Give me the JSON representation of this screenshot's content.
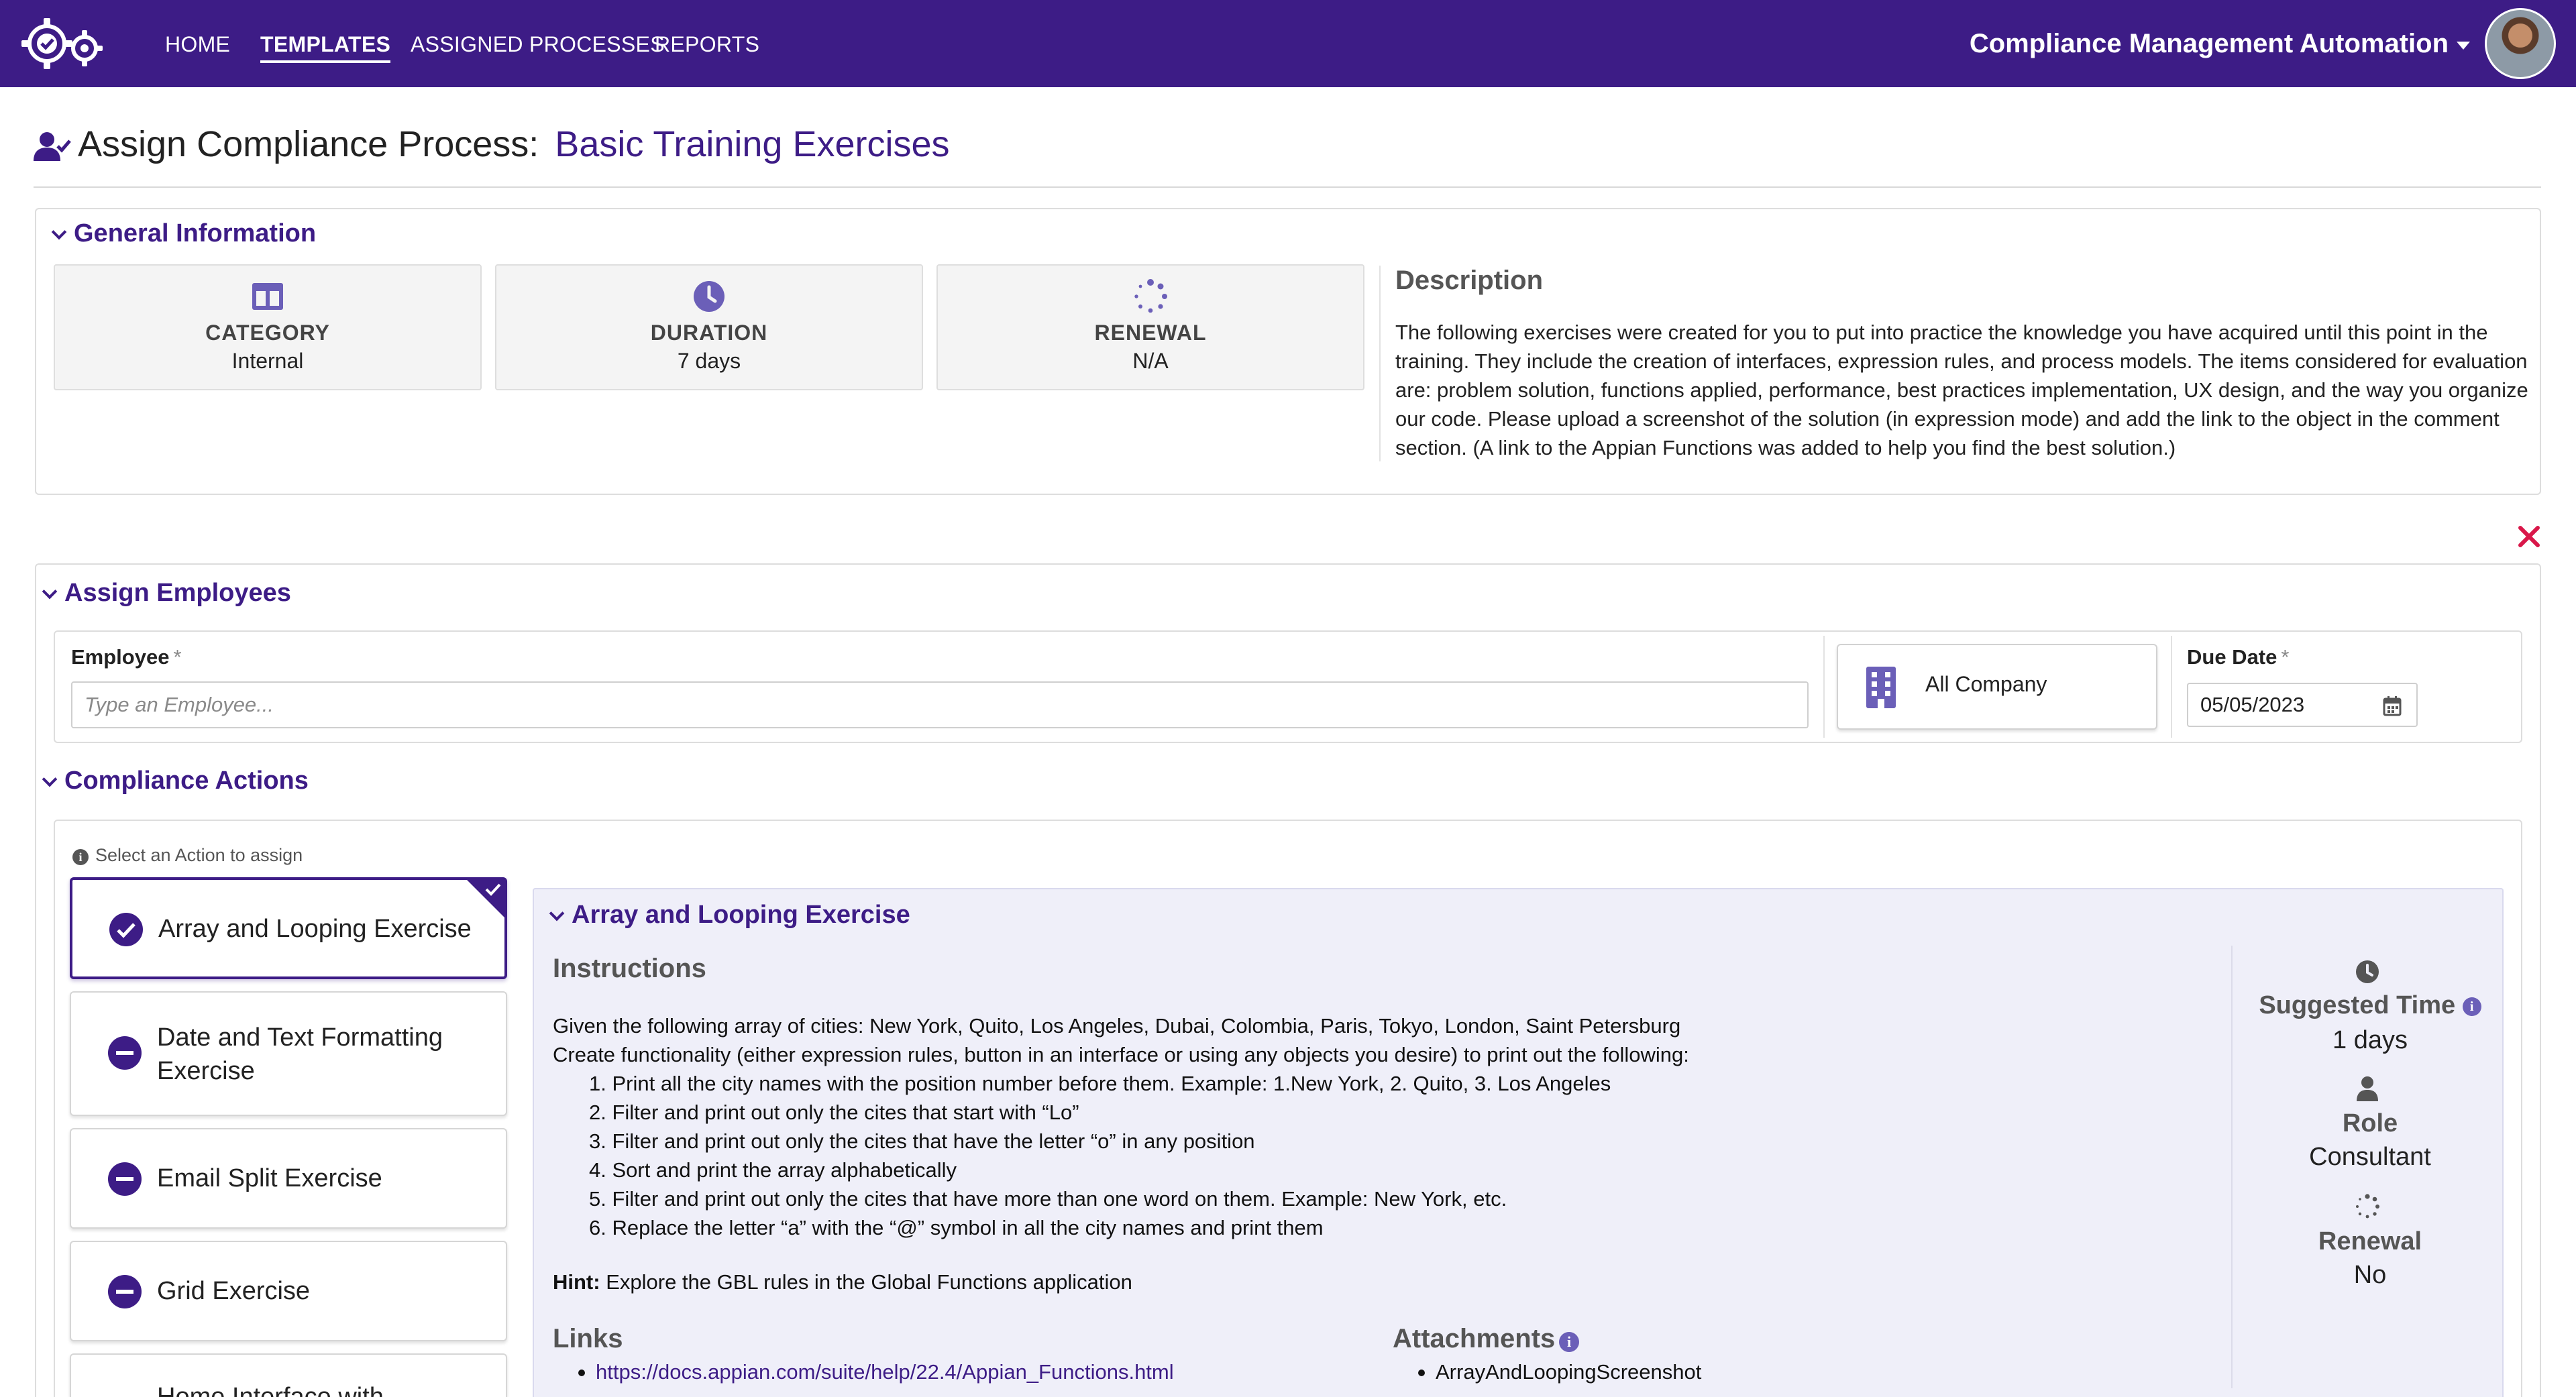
{
  "nav": {
    "items": [
      {
        "label": "HOME"
      },
      {
        "label": "TEMPLATES"
      },
      {
        "label": "ASSIGNED PROCESSES"
      },
      {
        "label": "REPORTS"
      }
    ],
    "active": "TEMPLATES",
    "app_title": "Compliance Management Automation"
  },
  "page": {
    "title_label": "Assign Compliance Process:",
    "title_value": "Basic Training Exercises"
  },
  "general": {
    "title": "General Information",
    "cards": [
      {
        "label": "CATEGORY",
        "value": "Internal",
        "icon": "layout-columns-icon"
      },
      {
        "label": "DURATION",
        "value": "7 days",
        "icon": "clock-icon"
      },
      {
        "label": "RENEWAL",
        "value": "N/A",
        "icon": "spinner-icon"
      }
    ],
    "description_title": "Description",
    "description": "The following exercises were created for you to put into practice the knowledge you have acquired until this point in the training. They include the creation of interfaces, expression rules, and process models. The items considered for evaluation are: problem solution, functions applied, performance, best practices implementation, UX design, and the way you organize our code. Please upload a screenshot of the solution (in expression mode) and add the link to the object in the comment section. (A link to the Appian Functions was added to help you find the best solution.)"
  },
  "assign": {
    "title": "Assign Employees",
    "employee_label": "Employee",
    "required_mark": "*",
    "employee_placeholder": "Type an Employee...",
    "company_button": "All Company",
    "due_label": "Due Date",
    "due_value": "05/05/2023"
  },
  "actions": {
    "title": "Compliance Actions",
    "hint": "Select an Action to assign",
    "items": [
      {
        "label": "Array and Looping Exercise",
        "selected": true
      },
      {
        "label": "Date and Text Formatting Exercise",
        "selected": false
      },
      {
        "label": "Email Split Exercise",
        "selected": false
      },
      {
        "label": "Grid Exercise",
        "selected": false
      },
      {
        "label": "Home Interface with",
        "selected": false
      }
    ]
  },
  "detail": {
    "title": "Array and Looping Exercise",
    "instructions_title": "Instructions",
    "intro_1": "Given the following array of cities: New York, Quito, Los Angeles, Dubai, Colombia, Paris, Tokyo, London, Saint Petersburg",
    "intro_2": "Create functionality (either expression rules, button in an interface or using any objects you desire) to print out the following:",
    "steps": [
      "1. Print all the city names with the position number before them. Example: 1.New York, 2. Quito, 3. Los Angeles",
      "2. Filter and print out only the cites that start with “Lo”",
      "3. Filter and print out only the cites that have the letter “o” in any position",
      "4. Sort and print the array alphabetically",
      "5. Filter and print out only the cites that have more than one word on them. Example: New York, etc.",
      "6. Replace the letter “a” with the “@” symbol in all the city names and print them"
    ],
    "hint_label": "Hint:",
    "hint_text": " Explore the GBL rules in the Global Functions application",
    "links_title": "Links",
    "link": "https://docs.appian.com/suite/help/22.4/Appian_Functions.html",
    "attachments_title": "Attachments",
    "attachment": "ArrayAndLoopingScreenshot",
    "suggested_time_label": "Suggested Time",
    "suggested_time_value": "1 days",
    "role_label": "Role",
    "role_value": "Consultant",
    "renewal_label": "Renewal",
    "renewal_value": "No"
  },
  "colors": {
    "brand": "#3d1c86",
    "accent_icon": "#6b5fb8",
    "close": "#d9184a"
  }
}
